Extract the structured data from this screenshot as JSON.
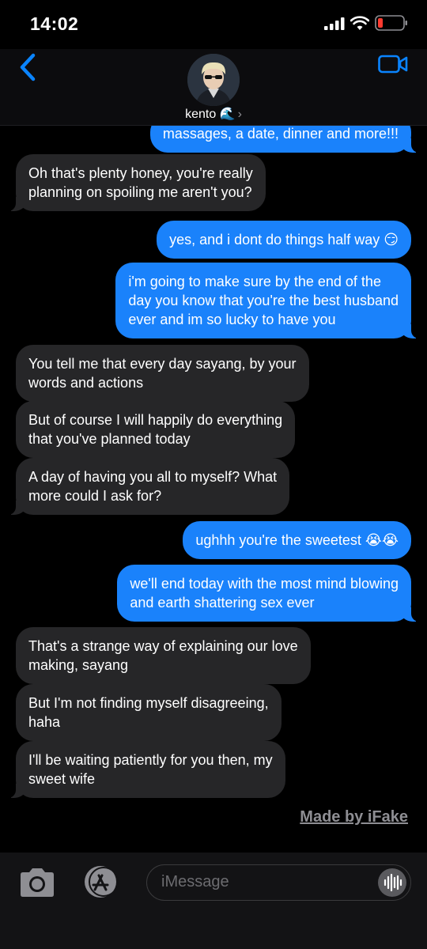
{
  "status_bar": {
    "time": "14:02"
  },
  "header": {
    "contact_name": "kento 🌊",
    "chevron": "›"
  },
  "icons": {
    "back": "chevron-left-icon",
    "video": "video-camera-icon",
    "camera": "camera-icon",
    "apps": "app-store-icon",
    "audio": "waveform-icon",
    "signal": "cellular-signal-icon",
    "wifi": "wifi-icon",
    "battery": "battery-low-icon"
  },
  "colors": {
    "outgoing_bubble": "#1a82fb",
    "incoming_bubble": "#262628",
    "accent": "#0a84ff",
    "battery_low": "#ff3b30"
  },
  "messages": [
    {
      "sender": "me",
      "lines": [
        "massages, a date, dinner and more!!!"
      ]
    },
    {
      "sender": "kento",
      "lines": [
        "Oh that's plenty honey, you're really",
        "planning on spoiling me aren't you?"
      ]
    },
    {
      "sender": "me",
      "lines": [
        "yes, and i dont do things half way 😏"
      ]
    },
    {
      "sender": "me",
      "lines": [
        "i'm going to make sure by the end of the",
        "day you know that you're the best husband",
        "ever and im so lucky to have you"
      ]
    },
    {
      "sender": "kento",
      "lines": [
        "You tell me that every day sayang, by your",
        "words and actions"
      ]
    },
    {
      "sender": "kento",
      "lines": [
        "But of course I will happily do everything",
        "that you've planned today"
      ]
    },
    {
      "sender": "kento",
      "lines": [
        "A day of having you all to myself? What",
        "more could I ask for?"
      ]
    },
    {
      "sender": "me",
      "lines": [
        "ughhh you're the sweetest 😭😭"
      ]
    },
    {
      "sender": "me",
      "lines": [
        "we'll end today with the most mind blowing",
        "and earth shattering sex ever"
      ]
    },
    {
      "sender": "kento",
      "lines": [
        "That's a strange way of explaining our love",
        "making, sayang"
      ]
    },
    {
      "sender": "kento",
      "lines": [
        "But I'm not finding myself disagreeing,",
        "haha"
      ]
    },
    {
      "sender": "kento",
      "lines": [
        "I'll be waiting patiently for you then, my",
        "sweet wife"
      ]
    }
  ],
  "watermark": "Made by iFake",
  "input": {
    "placeholder": "iMessage"
  }
}
